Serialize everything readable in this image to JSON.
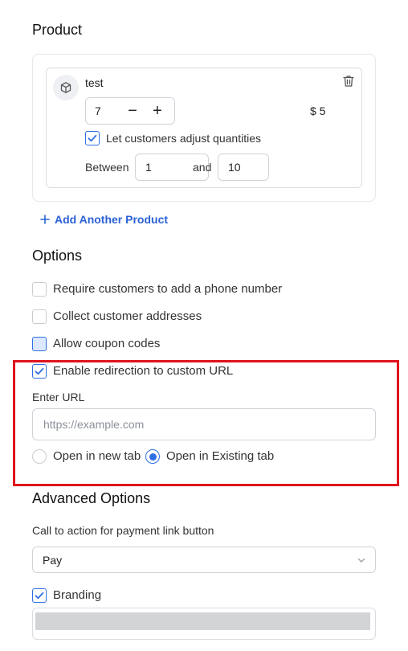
{
  "product_section": {
    "title": "Product",
    "product": {
      "name": "test",
      "quantity": "7",
      "minus": "−",
      "plus": "+",
      "price": "$ 5",
      "adjust_label": "Let customers adjust quantities",
      "adjust_checked": true,
      "between_label": "Between",
      "min": "1",
      "and_label": "and",
      "max": "10"
    },
    "add_another": "Add Another Product"
  },
  "options_section": {
    "title": "Options",
    "items": [
      {
        "label": "Require customers to add a phone number",
        "checked": false
      },
      {
        "label": "Collect customer addresses",
        "checked": false
      },
      {
        "label": "Allow coupon codes",
        "checked": false
      },
      {
        "label": "Enable redirection to custom URL",
        "checked": true
      }
    ],
    "url_label": "Enter URL",
    "url_placeholder": "https://example.com",
    "open_new_tab": "Open in new tab",
    "open_existing_tab": "Open in Existing tab",
    "selected_tab_option": "Open in Existing tab"
  },
  "advanced_section": {
    "title": "Advanced Options",
    "cta_label": "Call to action for payment link button",
    "cta_value": "Pay",
    "branding_label": "Branding",
    "branding_checked": true
  },
  "colors": {
    "accent": "#2f6fe4",
    "link": "#2a62d6",
    "highlight_border": "#e0141e"
  }
}
